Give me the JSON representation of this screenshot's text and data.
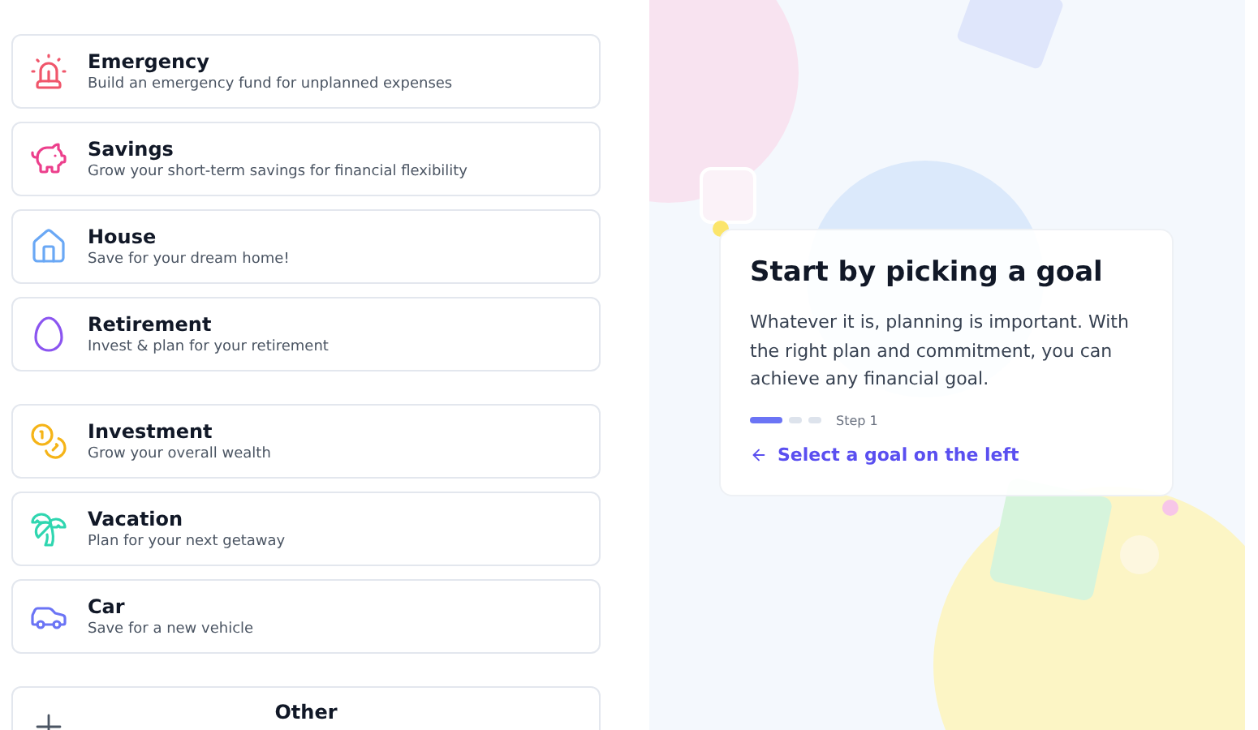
{
  "goal_groups": [
    {
      "goals": [
        {
          "kind": "siren",
          "color": "#f0566b",
          "title": "Emergency",
          "subtitle": "Build an emergency fund for unplanned expenses"
        },
        {
          "kind": "piggy",
          "color": "#ec3f8c",
          "title": "Savings",
          "subtitle": "Grow your short-term savings for financial flexibility"
        },
        {
          "kind": "house",
          "color": "#6aa8f5",
          "title": "House",
          "subtitle": "Save for your dream home!"
        },
        {
          "kind": "egg",
          "color": "#8b55f0",
          "title": "Retirement",
          "subtitle": "Invest & plan for your retirement"
        }
      ]
    },
    {
      "goals": [
        {
          "kind": "coins",
          "color": "#f5b418",
          "title": "Investment",
          "subtitle": "Grow your overall wealth"
        },
        {
          "kind": "palm",
          "color": "#2fd6b0",
          "title": "Vacation",
          "subtitle": "Plan for your next getaway"
        },
        {
          "kind": "car",
          "color": "#6b74f5",
          "title": "Car",
          "subtitle": "Save for a new vehicle"
        }
      ]
    }
  ],
  "other": {
    "title": "Other"
  },
  "intro_card": {
    "title": "Start by picking a goal",
    "body": "Whatever it is, planning is important. With the right plan and commitment, you can achieve any financial goal.",
    "steps": [
      {
        "selected": true
      },
      {
        "selected": false
      },
      {
        "selected": false
      }
    ],
    "step_label": "Step 1",
    "link": "Select a goal on the left"
  }
}
